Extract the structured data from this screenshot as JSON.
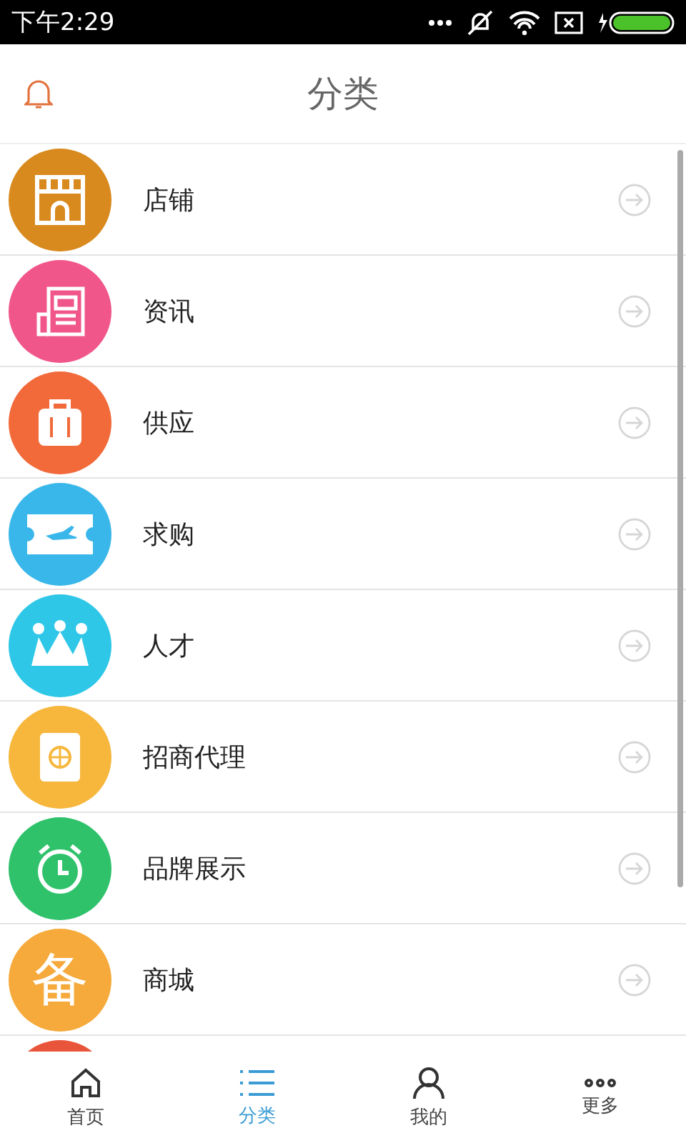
{
  "status_bar": {
    "time": "下午2:29"
  },
  "header": {
    "title": "分类"
  },
  "categories": [
    {
      "kind": "store",
      "label": "店铺",
      "color": "#d98a1e"
    },
    {
      "kind": "news",
      "label": "资讯",
      "color": "#f0568a"
    },
    {
      "kind": "luggage",
      "label": "供应",
      "color": "#f26a3a"
    },
    {
      "kind": "ticket",
      "label": "求购",
      "color": "#3ab7ea"
    },
    {
      "kind": "crown",
      "label": "人才",
      "color": "#2ec7e8"
    },
    {
      "kind": "passport",
      "label": "招商代理",
      "color": "#f6b73c"
    },
    {
      "kind": "clock",
      "label": "品牌展示",
      "color": "#2fc26b"
    },
    {
      "kind": "glyph",
      "glyph": "备",
      "label": "商城",
      "color": "#f6aa3c"
    },
    {
      "kind": "partial",
      "color": "#e8553a"
    }
  ],
  "tabs": [
    {
      "kind": "home",
      "label": "首页",
      "selected": false
    },
    {
      "kind": "list",
      "label": "分类",
      "selected": true
    },
    {
      "kind": "user",
      "label": "我的",
      "selected": false
    },
    {
      "kind": "more",
      "label": "更多",
      "selected": false
    }
  ]
}
